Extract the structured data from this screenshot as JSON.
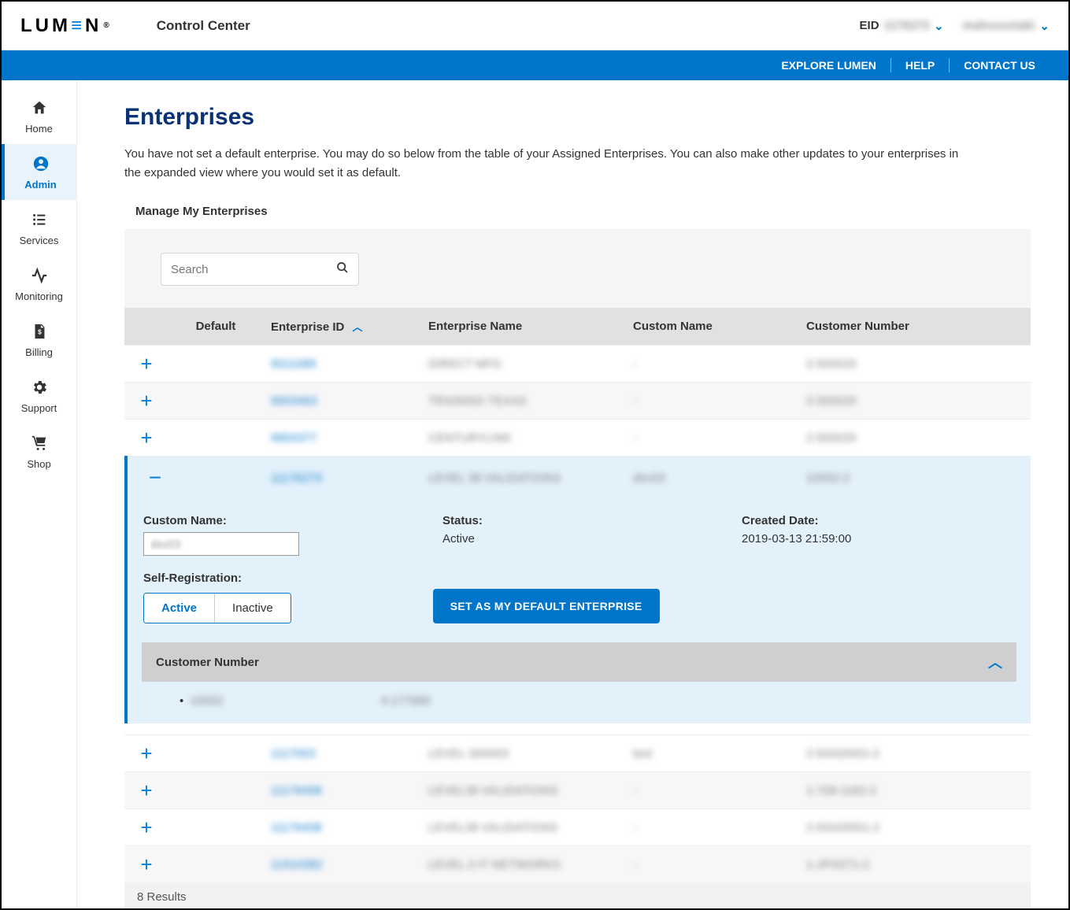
{
  "header": {
    "logo_text": "LUMEN",
    "app_title": "Control Center",
    "eid_label": "EID",
    "eid_value": "1176273",
    "username": "mahousstaki"
  },
  "bluebar": {
    "explore": "EXPLORE LUMEN",
    "help": "HELP",
    "contact": "CONTACT US"
  },
  "sidebar": [
    {
      "id": "home",
      "label": "Home"
    },
    {
      "id": "admin",
      "label": "Admin"
    },
    {
      "id": "services",
      "label": "Services"
    },
    {
      "id": "monitoring",
      "label": "Monitoring"
    },
    {
      "id": "billing",
      "label": "Billing"
    },
    {
      "id": "support",
      "label": "Support"
    },
    {
      "id": "shop",
      "label": "Shop"
    }
  ],
  "page": {
    "title": "Enterprises",
    "description": "You have not set a default enterprise. You may do so below from the table of your Assigned Enterprises. You can also make other updates to your enterprises in the expanded view where you would set it as default.",
    "section_label": "Manage My Enterprises",
    "search_placeholder": "Search"
  },
  "table": {
    "columns": {
      "default": "Default",
      "enterprise_id": "Enterprise ID",
      "enterprise_name": "Enterprise Name",
      "custom_name": "Custom Name",
      "customer_number": "Customer Number"
    },
    "rows": [
      {
        "enterprise_id": "9011089",
        "enterprise_name": "DIRECT MFG",
        "custom_name": "-",
        "customer_number": "2-500029"
      },
      {
        "enterprise_id": "9903463",
        "enterprise_name": "TRAINING TEXAS",
        "custom_name": "-",
        "customer_number": "2-500029"
      },
      {
        "enterprise_id": "9904377",
        "enterprise_name": "CENTURYLINK",
        "custom_name": "-",
        "customer_number": "2-500029"
      },
      {
        "enterprise_id": "11176273",
        "enterprise_name": "LEVEL 38 VALIDATIONS",
        "custom_name": "dev03",
        "customer_number": "10002-2"
      }
    ],
    "rows_after": [
      {
        "enterprise_id": "1117003",
        "enterprise_name": "LEVEL-300003",
        "custom_name": "test",
        "customer_number": "2-50420001-2"
      },
      {
        "enterprise_id": "11176408",
        "enterprise_name": "LEVEL38 VALIDATIONS",
        "custom_name": "-",
        "customer_number": "1-708-1182-2"
      },
      {
        "enterprise_id": "11176408",
        "enterprise_name": "LEVEL38 VALIDATIONS",
        "custom_name": "-",
        "customer_number": "2-50420001-2"
      },
      {
        "enterprise_id": "11910382",
        "enterprise_name": "LEVEL 2-IT NETWORKS",
        "custom_name": "-",
        "customer_number": "1-JPH271-2"
      }
    ],
    "expanded": {
      "custom_name_label": "Custom Name:",
      "custom_name_value": "dev03",
      "status_label": "Status:",
      "status_value": "Active",
      "created_label": "Created Date:",
      "created_value": "2019-03-13 21:59:00",
      "selfreg_label": "Self-Registration:",
      "toggle_active": "Active",
      "toggle_inactive": "Inactive",
      "set_default_btn": "SET AS MY DEFAULT ENTERPRISE",
      "custnum_header": "Customer Number",
      "custnum_row_a": "10002",
      "custnum_row_b": "4-177980"
    },
    "results_text": "8 Results"
  }
}
